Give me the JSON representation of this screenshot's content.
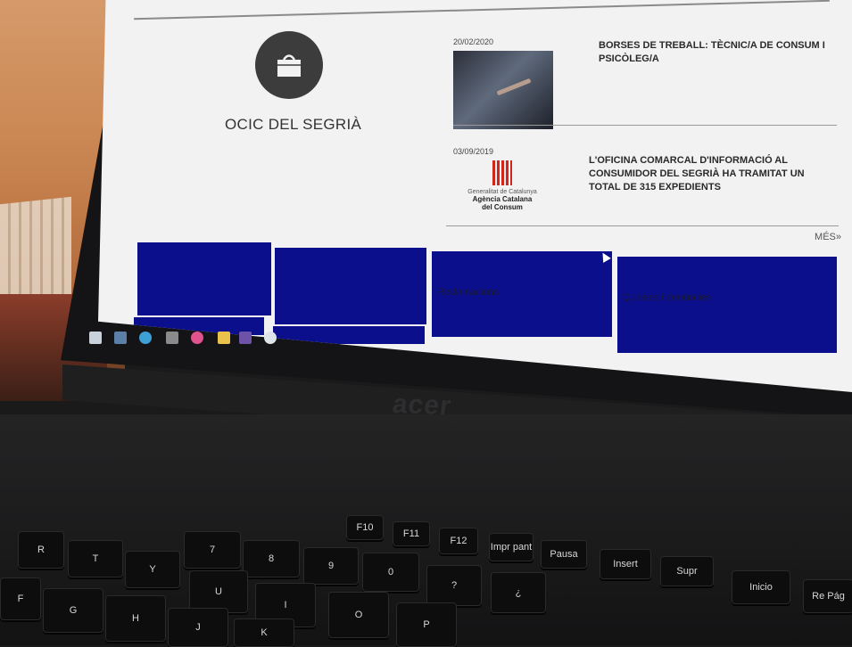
{
  "laptop": {
    "brand": "acer"
  },
  "site": {
    "logo_title": "OCIC DEL SEGRIÀ",
    "news": [
      {
        "date": "20/02/2020",
        "headline": "BORSES DE TREBALL: TÈCNIC/A DE CONSUM I PSICÒLEG/A"
      },
      {
        "date": "03/09/2019",
        "headline": "L'OFICINA COMARCAL D'INFORMACIÓ AL CONSUMIDOR DEL SEGRIÀ HA TRAMITAT UN TOTAL DE 315 EXPEDIENTS"
      }
    ],
    "gencat": {
      "line1": "Generalitat de Catalunya",
      "line2": "Agència Catalana",
      "line3": "del Consum"
    },
    "more_link": "MÉS»",
    "tiles": [
      "",
      "",
      "Reclamacions",
      "Queixes i denúncies"
    ]
  },
  "keyboard": {
    "keys": [
      "F10",
      "F11",
      "F12",
      "Impr pant",
      "Pausa",
      "Insert",
      "Supr",
      "Inicio",
      "Re Pág",
      "9",
      "0",
      "?",
      "¿",
      "8",
      "7",
      "U",
      "I",
      "O",
      "P",
      "H",
      "J",
      "K",
      "G",
      "F",
      "Y",
      "T",
      "R"
    ]
  },
  "colors": {
    "tile": "#0b0f8c",
    "logo": "#3c3c3c",
    "gencat_red": "#d0261b"
  }
}
